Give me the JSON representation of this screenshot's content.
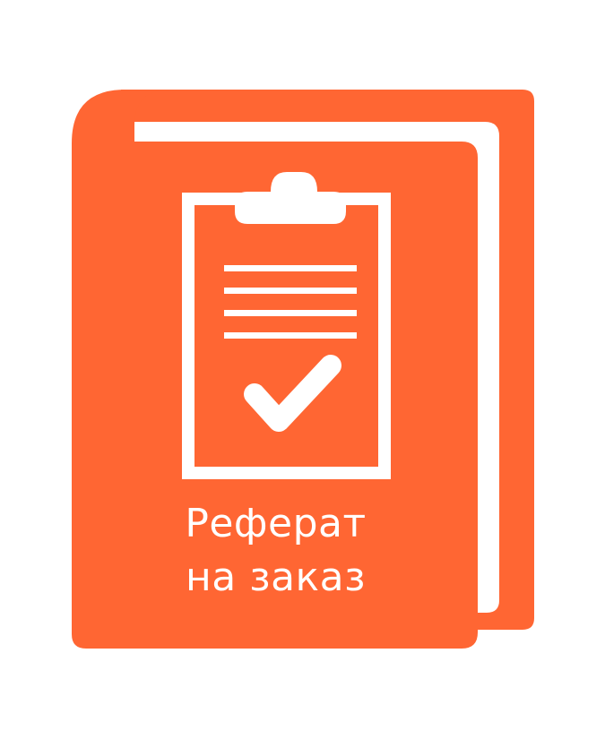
{
  "brand": {
    "accent_color": "#FF6633",
    "background_color": "#FFFFFF",
    "icon": "clipboard-check-icon",
    "title_line1": "Реферат",
    "title_line2": "на заказ"
  }
}
